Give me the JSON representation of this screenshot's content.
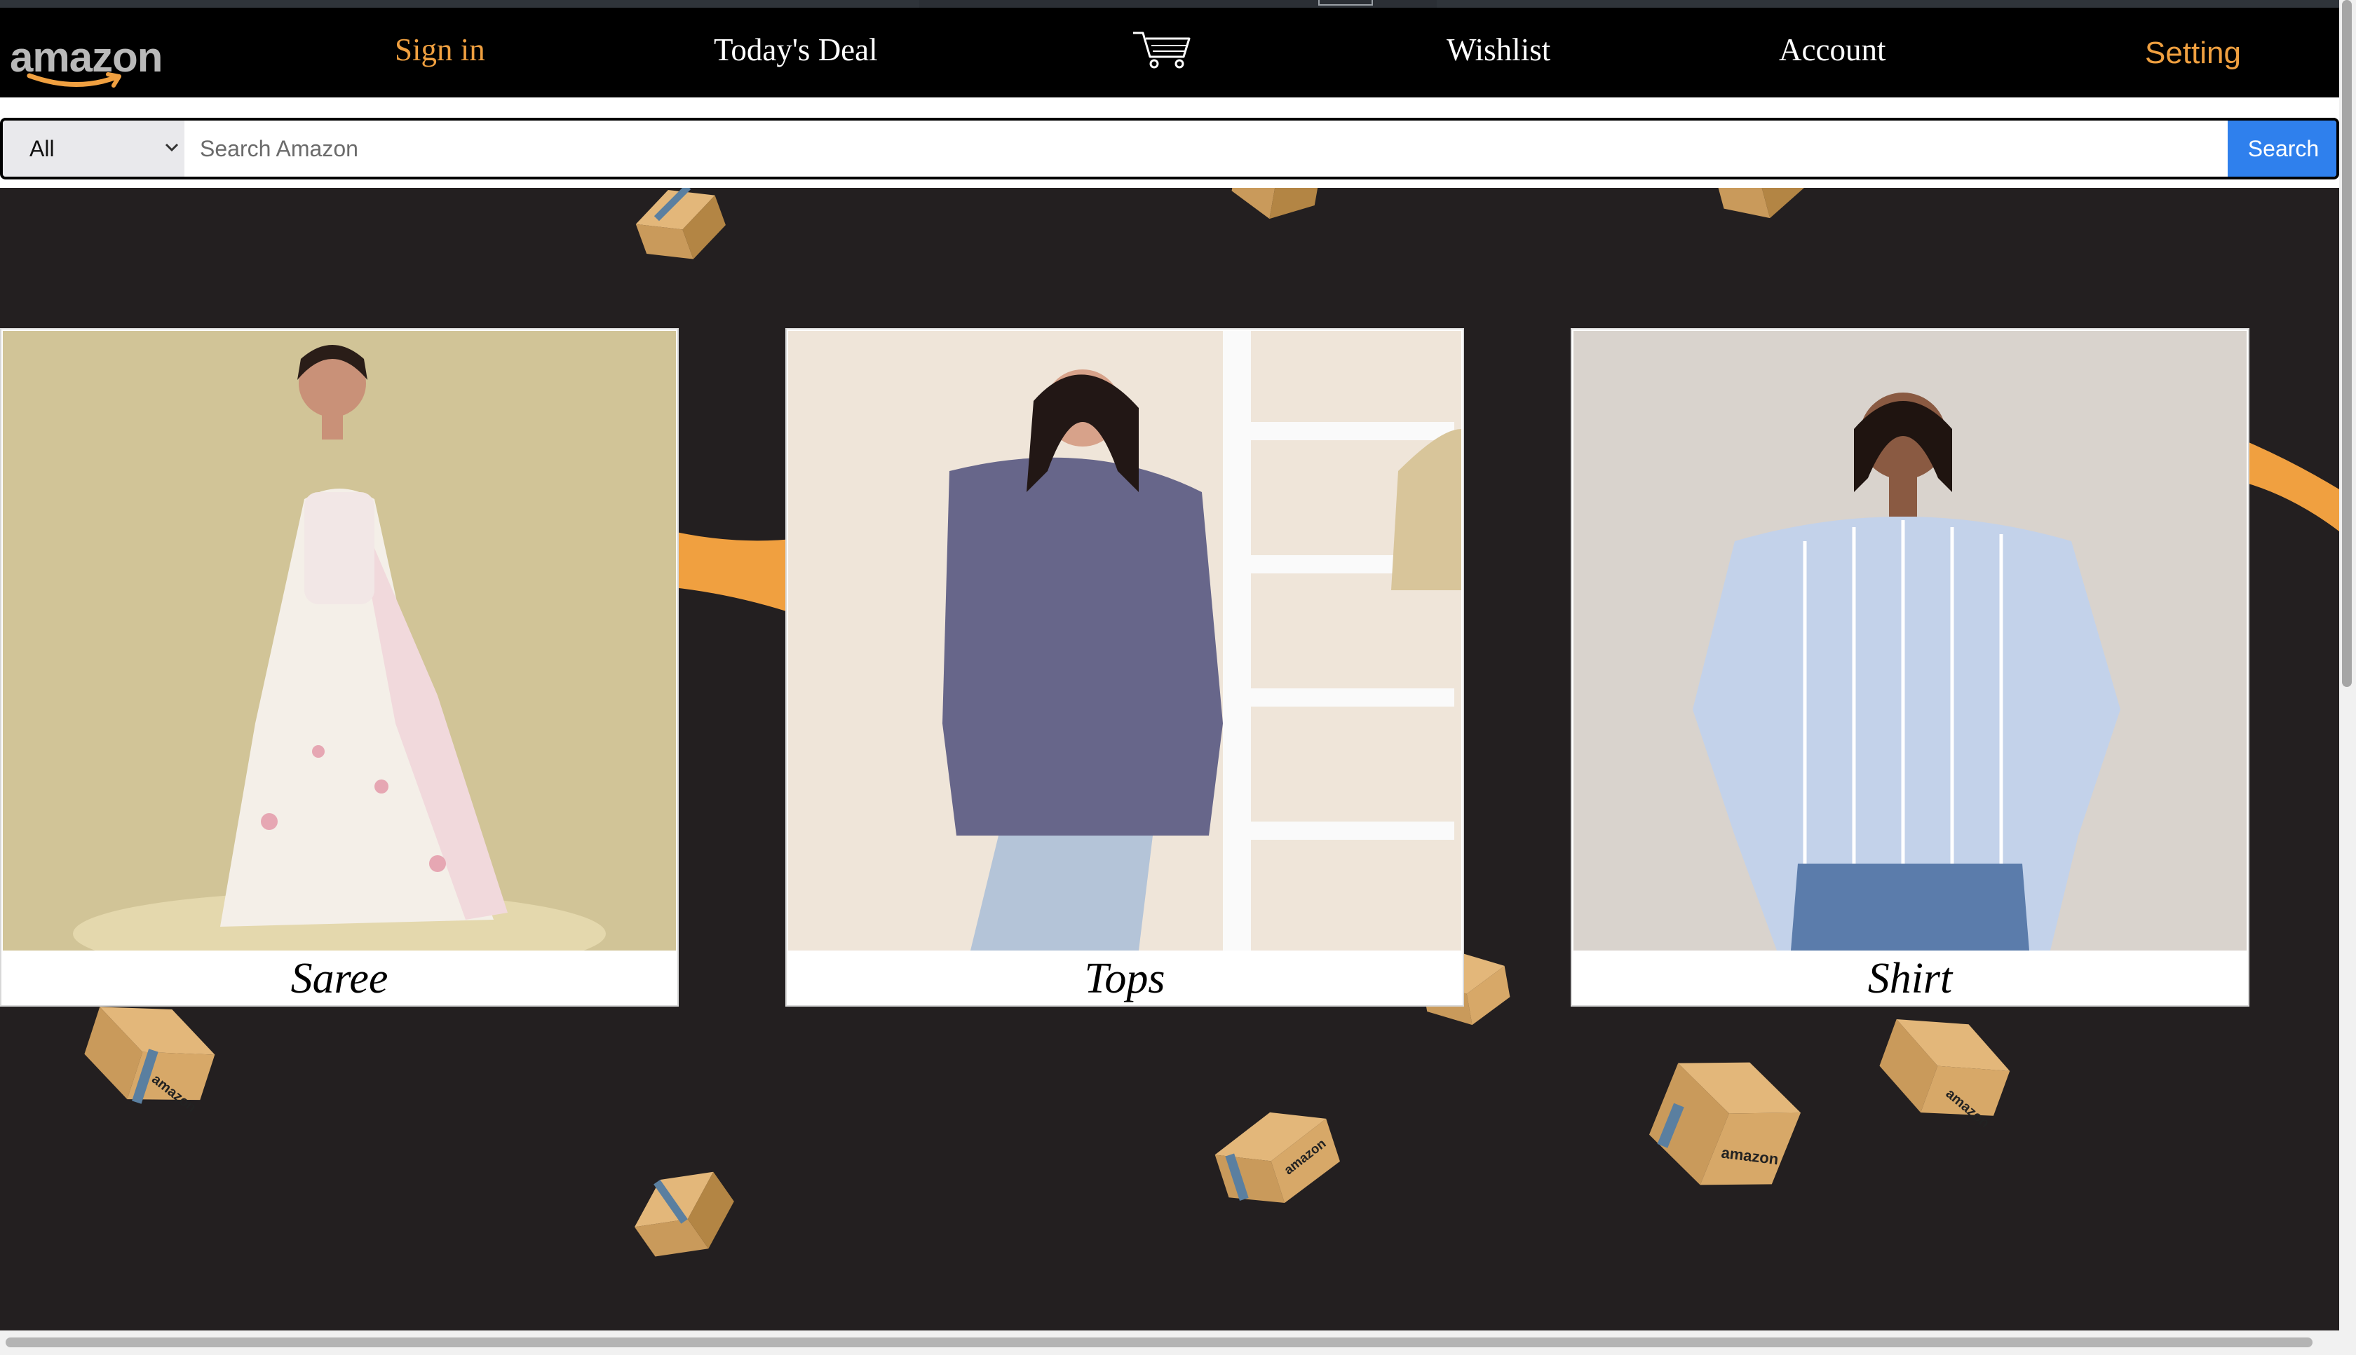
{
  "header": {
    "logo_text": "amazon",
    "nav": {
      "sign_in": "Sign in",
      "todays_deal": "Today's Deal",
      "wishlist": "Wishlist",
      "account": "Account",
      "setting": "Setting"
    },
    "cart_icon": "shopping-cart-icon"
  },
  "search": {
    "category": "All",
    "placeholder": "Search Amazon",
    "value": "",
    "button_label": "Search"
  },
  "hero": {
    "decoration": "falling-amazon-boxes",
    "box_print": "amazon"
  },
  "categories": [
    {
      "label": "Saree",
      "image": "woman in white floral saree"
    },
    {
      "label": "Tops",
      "image": "woman in purple top beside ladder"
    },
    {
      "label": "Shirt",
      "image": "woman in blue striped shirt"
    }
  ],
  "colors": {
    "accent_orange": "#f0a040",
    "navbar_bg": "#000000",
    "hero_bg": "#231f20",
    "search_button": "#2f80ed"
  }
}
